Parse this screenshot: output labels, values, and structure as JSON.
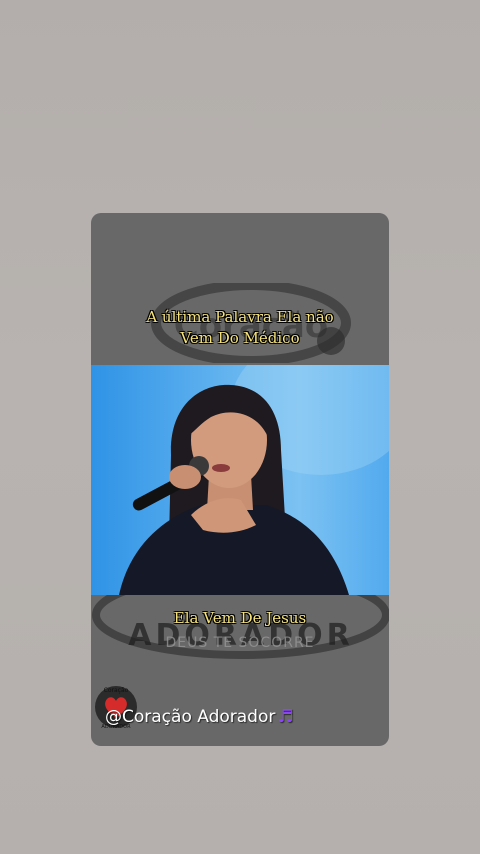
{
  "caption_top": [
    "A última Palavra Ela não",
    "Vem Do Médico"
  ],
  "caption_bottom": "Ela Vem De Jesus",
  "watermark": {
    "brand": "ADORADOR",
    "subtext": "DEUS TE SOCORRE",
    "logo_text_top": "Coração",
    "logo_text_bottom": "ADORADOR"
  },
  "handle": "@Coração Adorador",
  "icons": {
    "music_note": "music-notes-icon"
  },
  "colors": {
    "background": "#b5b0ad",
    "card": "#686868",
    "caption": "#f5e27a",
    "video_sky": "#62b3ef",
    "accent_note": "#8e44ff"
  }
}
